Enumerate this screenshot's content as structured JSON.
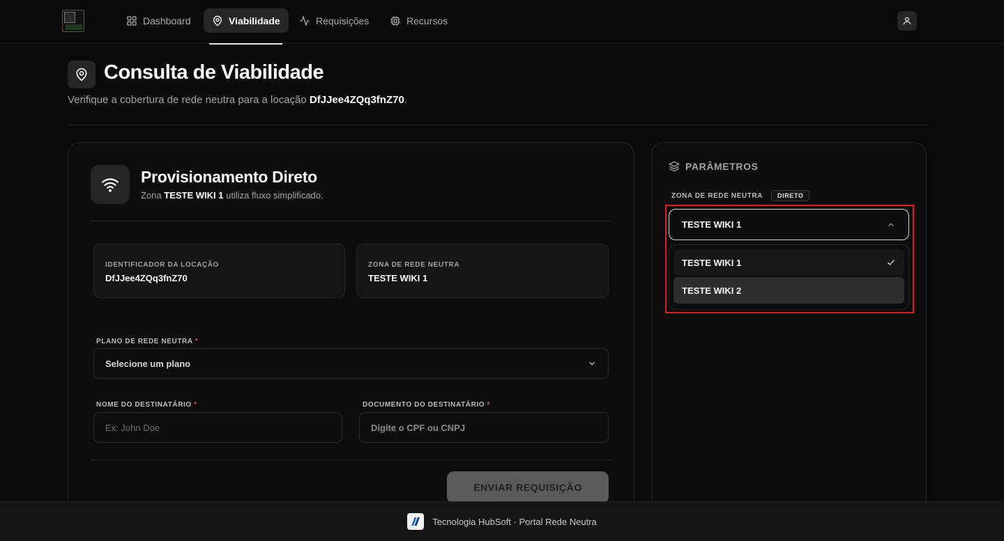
{
  "nav": {
    "items": [
      {
        "label": "Dashboard",
        "icon": "grid-icon",
        "active": false
      },
      {
        "label": "Viabilidade",
        "icon": "map-pin-icon",
        "active": true
      },
      {
        "label": "Requisições",
        "icon": "activity-icon",
        "active": false
      },
      {
        "label": "Recursos",
        "icon": "cpu-icon",
        "active": false
      }
    ]
  },
  "header": {
    "title": "Consulta de Viabilidade",
    "subtitle_prefix": "Verifique a cobertura de rede neutra para a locação ",
    "location_id": "DfJJee4ZQq3fnZ70",
    "subtitle_suffix": "."
  },
  "provision": {
    "title": "Provisionamento Direto",
    "sub_prefix": "Zona ",
    "zone": "TESTE WIKI 1",
    "sub_suffix": " utiliza fluxo simplificado."
  },
  "info": {
    "location_label": "IDENTIFICADOR DA LOCAÇÃO",
    "location_value": "DfJJee4ZQq3fnZ70",
    "zone_label": "ZONA DE REDE NEUTRA",
    "zone_value": "TESTE WIKI 1"
  },
  "form": {
    "plan_label": "PLANO DE REDE NEUTRA",
    "plan_placeholder": "Selecione um plano",
    "name_label": "NOME DO DESTINATÁRIO",
    "name_placeholder": "Ex: John Doe",
    "doc_label": "DOCUMENTO DO DESTINATÁRIO",
    "doc_placeholder": "Digite o CPF ou CNPJ",
    "required_mark": "*",
    "submit": "ENVIAR REQUISIÇÃO"
  },
  "params": {
    "title": "PARÂMETROS",
    "zone_label": "ZONA DE REDE NEUTRA",
    "badge": "DIRETO",
    "selected": "TESTE WIKI 1",
    "options": [
      "TESTE WIKI 1",
      "TESTE WIKI 2"
    ]
  },
  "footer": {
    "text": "Tecnologia HubSoft · Portal Rede Neutra"
  },
  "colors": {
    "background": "#0a0a0a",
    "card": "#0d0d0d",
    "required": "#ef4444",
    "highlight": "#e11d1d"
  }
}
